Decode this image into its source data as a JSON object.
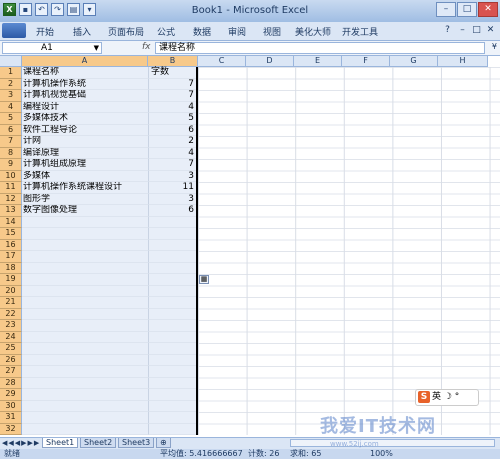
{
  "window": {
    "title": "Book1 - Microsoft Excel"
  },
  "ribbon_tabs": [
    "开始",
    "插入",
    "页面布局",
    "公式",
    "数据",
    "审阅",
    "视图",
    "美化大师",
    "开发工具"
  ],
  "formula_bar": {
    "name_box": "A1",
    "fx": "fx",
    "content": "课程名称"
  },
  "columns": [
    "A",
    "B",
    "C",
    "D",
    "E",
    "F",
    "G",
    "H"
  ],
  "rows": [
    {
      "n": "1",
      "a": "课程名称",
      "b": "字数"
    },
    {
      "n": "2",
      "a": "计算机操作系统",
      "b": "7"
    },
    {
      "n": "3",
      "a": "计算机视觉基础",
      "b": "7"
    },
    {
      "n": "4",
      "a": "编程设计",
      "b": "4"
    },
    {
      "n": "5",
      "a": "多媒体技术",
      "b": "5"
    },
    {
      "n": "6",
      "a": "软件工程导论",
      "b": "6"
    },
    {
      "n": "7",
      "a": "计网",
      "b": "2"
    },
    {
      "n": "8",
      "a": "编译原理",
      "b": "4"
    },
    {
      "n": "9",
      "a": "计算机组成原理",
      "b": "7"
    },
    {
      "n": "10",
      "a": "多媒体",
      "b": "3"
    },
    {
      "n": "11",
      "a": "计算机操作系统课程设计",
      "b": "11"
    },
    {
      "n": "12",
      "a": "图形学",
      "b": "3"
    },
    {
      "n": "13",
      "a": "数字图像处理",
      "b": "6"
    },
    {
      "n": "14",
      "a": "",
      "b": ""
    },
    {
      "n": "15",
      "a": "",
      "b": ""
    },
    {
      "n": "16",
      "a": "",
      "b": ""
    },
    {
      "n": "17",
      "a": "",
      "b": ""
    },
    {
      "n": "18",
      "a": "",
      "b": ""
    },
    {
      "n": "19",
      "a": "",
      "b": ""
    },
    {
      "n": "20",
      "a": "",
      "b": ""
    },
    {
      "n": "21",
      "a": "",
      "b": ""
    },
    {
      "n": "22",
      "a": "",
      "b": ""
    },
    {
      "n": "23",
      "a": "",
      "b": ""
    },
    {
      "n": "24",
      "a": "",
      "b": ""
    },
    {
      "n": "25",
      "a": "",
      "b": ""
    },
    {
      "n": "26",
      "a": "",
      "b": ""
    },
    {
      "n": "27",
      "a": "",
      "b": ""
    },
    {
      "n": "28",
      "a": "",
      "b": ""
    },
    {
      "n": "29",
      "a": "",
      "b": ""
    },
    {
      "n": "30",
      "a": "",
      "b": ""
    },
    {
      "n": "31",
      "a": "",
      "b": ""
    },
    {
      "n": "32",
      "a": "",
      "b": ""
    }
  ],
  "sheet_tabs": [
    "Sheet1",
    "Sheet2",
    "Sheet3"
  ],
  "status": {
    "mode": "就绪",
    "average": "平均值: 5.416666667",
    "count": "计数: 26",
    "sum": "求和: 65",
    "zoom": "100%"
  },
  "ime": {
    "label": "英"
  },
  "watermark": {
    "text": "我爱IT技术网",
    "url": "www.52ij.com"
  }
}
